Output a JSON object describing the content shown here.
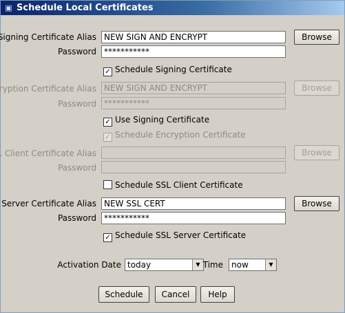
{
  "window": {
    "title": "Schedule Local Certificates"
  },
  "signing": {
    "alias_label": "Signing Certificate Alias",
    "alias_value": "NEW SIGN AND ENCRYPT",
    "browse_label": "Browse",
    "password_label": "Password",
    "password_value": "***********",
    "schedule_label": "Schedule Signing Certificate",
    "schedule_checked": "✓"
  },
  "encryption": {
    "alias_label": "Encryption Certificate Alias",
    "alias_value": "NEW SIGN AND ENCRYPT",
    "browse_label": "Browse",
    "password_label": "Password",
    "password_value": "***********",
    "use_signing_label": "Use Signing Certificate",
    "use_signing_checked": "✓",
    "schedule_label": "Schedule Encryption Certificate",
    "schedule_checked": "✓"
  },
  "ssl_client": {
    "alias_label": "SSL Client Certificate Alias",
    "alias_value": "",
    "browse_label": "Browse",
    "password_label": "Password",
    "password_value": "",
    "schedule_label": "Schedule SSL Client Certificate",
    "schedule_checked": ""
  },
  "ssl_server": {
    "alias_label": "SSL Server Certificate Alias",
    "alias_value": "NEW SSL CERT",
    "browse_label": "Browse",
    "password_label": "Password",
    "password_value": "***********",
    "schedule_label": "Schedule SSL Server Certificate",
    "schedule_checked": "✓"
  },
  "activation": {
    "date_label": "Activation Date",
    "date_value": "today",
    "time_label": "Time",
    "time_value": "now"
  },
  "buttons": {
    "schedule": "Schedule",
    "cancel": "Cancel",
    "help": "Help"
  }
}
